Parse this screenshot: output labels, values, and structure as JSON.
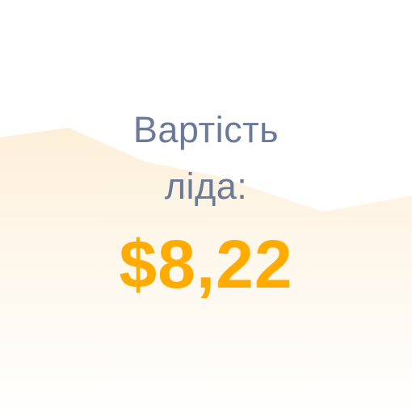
{
  "card": {
    "label_line_1": "Вартість",
    "label_line_2": "ліда:",
    "value": "$8,22"
  },
  "colors": {
    "label": "#6b7a99",
    "value": "#ffab00",
    "wave_top": "#fdf0da",
    "wave_bottom": "#ffffff"
  }
}
